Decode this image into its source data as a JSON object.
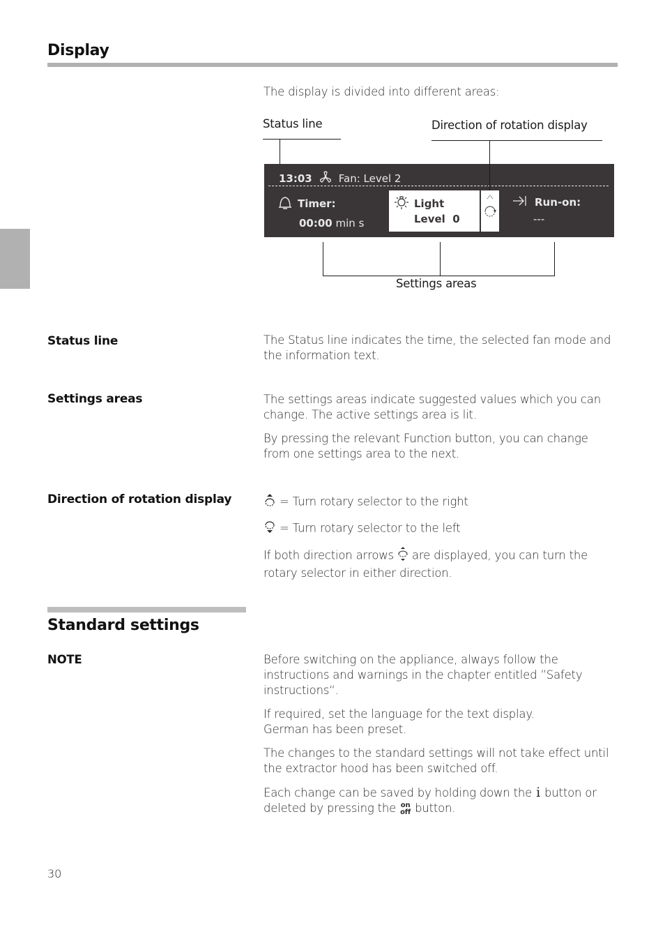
{
  "section_display": {
    "title": "Display",
    "intro": "The display is divided into different areas:"
  },
  "diagram": {
    "label_status_line": "Status line",
    "label_direction": "Direction of rotation display",
    "label_settings_areas": "Settings areas",
    "lcd": {
      "time": "13:03",
      "fan_icon": "fan-icon",
      "fan_text": "Fan: Level 2",
      "timer_label": "Timer:",
      "timer_value": "00:00",
      "timer_unit": "min s",
      "light_label": "Light",
      "light_value": "Level  0",
      "runon_label": "Run-on:",
      "runon_value": "---"
    },
    "colors": {
      "lcd_background": "#3a3637",
      "lcd_foreground": "#e8e8e8",
      "active_area": "#ffffff"
    }
  },
  "rows": {
    "status_line": {
      "label": "Status line",
      "text": "The Status line indicates the time, the selected fan mode and the information text."
    },
    "settings_areas": {
      "label": "Settings areas",
      "text1": "The settings areas indicate suggested values which you can change. The active settings area is lit.",
      "text2": "By pressing the relevant Function button, you can change from one settings area to the next."
    },
    "direction": {
      "label": "Direction of rotation display",
      "right": "= Turn rotary selector to the right",
      "left": "= Turn rotary selector to the left",
      "both_pre": "If both direction arrows",
      "both_post": "are displayed, you can turn the rotary selector in either direction."
    }
  },
  "section_standard": {
    "title": "Standard settings",
    "note_label": "NOTE",
    "p1": "Before switching on the appliance, always follow the instructions and warnings in the chapter entitled ”Safety instructions“.",
    "p2a": "If required, set the language for the text display.",
    "p2b": "German has been preset.",
    "p3": "The changes to the standard settings will not take effect until the extractor hood has been switched off.",
    "p4_pre": "Each change can be saved by holding down the",
    "p4_i": "i",
    "p4_mid": "button or deleted by pressing the",
    "p4_on": "on",
    "p4_off": "off",
    "p4_post": "button."
  },
  "footer": {
    "page_number": "30"
  }
}
